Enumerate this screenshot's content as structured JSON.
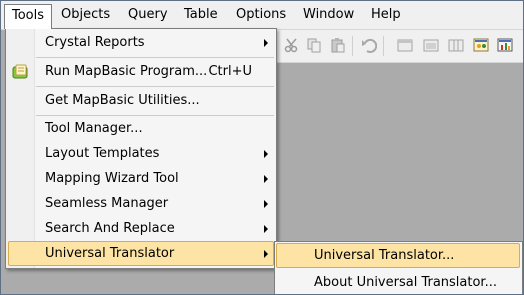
{
  "menubar": {
    "items": [
      {
        "label": "Tools"
      },
      {
        "label": "Objects"
      },
      {
        "label": "Query"
      },
      {
        "label": "Table"
      },
      {
        "label": "Options"
      },
      {
        "label": "Window"
      },
      {
        "label": "Help"
      }
    ]
  },
  "tools_menu": {
    "items": [
      {
        "label": "Crystal Reports",
        "submenu": true
      },
      {
        "label": "Run MapBasic Program...",
        "shortcut": "Ctrl+U",
        "icon": "mapbasic-program-icon"
      },
      {
        "label": "Get MapBasic Utilities..."
      },
      {
        "label": "Tool Manager..."
      },
      {
        "label": "Layout Templates",
        "submenu": true
      },
      {
        "label": "Mapping Wizard Tool",
        "submenu": true
      },
      {
        "label": "Seamless Manager",
        "submenu": true
      },
      {
        "label": "Search And Replace",
        "submenu": true
      },
      {
        "label": "Universal Translator",
        "submenu": true,
        "highlighted": true
      }
    ]
  },
  "submenu": {
    "items": [
      {
        "label": "Universal Translator...",
        "highlighted": true
      },
      {
        "label": "About Universal Translator..."
      }
    ]
  },
  "colors": {
    "highlight": "#fde3a4",
    "highlight_border": "#d9ac4d",
    "workspace": "#ababab",
    "menu_bg": "#f5f5f5"
  }
}
